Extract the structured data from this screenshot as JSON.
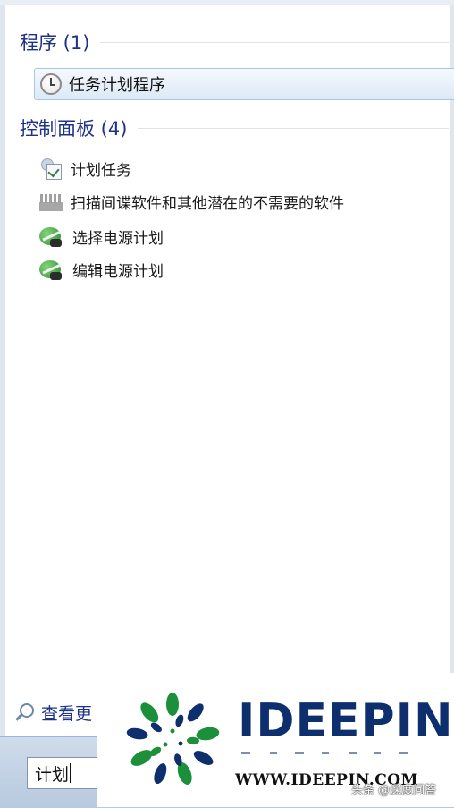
{
  "programs": {
    "header": "程序 (1)",
    "items": [
      {
        "label": "任务计划程序",
        "icon": "clock-icon"
      }
    ]
  },
  "control_panel": {
    "header": "控制面板 (4)",
    "items": [
      {
        "label": "计划任务",
        "icon": "scheduled-task-icon"
      },
      {
        "label": "扫描间谍软件和其他潜在的不需要的软件",
        "icon": "firewall-icon"
      },
      {
        "label": "选择电源计划",
        "icon": "power-plan-icon"
      },
      {
        "label": "编辑电源计划",
        "icon": "power-plan-icon"
      }
    ]
  },
  "see_more": {
    "label": "查看更"
  },
  "search": {
    "value": "计划"
  },
  "overlay": {
    "brand": "IDEEPIN",
    "url": "WWW.IDEEPIN.COM",
    "watermark": "头条 @深度问答",
    "colors": {
      "brand_blue": "#0e2f6d",
      "brand_green": "#1b8f3a"
    }
  }
}
